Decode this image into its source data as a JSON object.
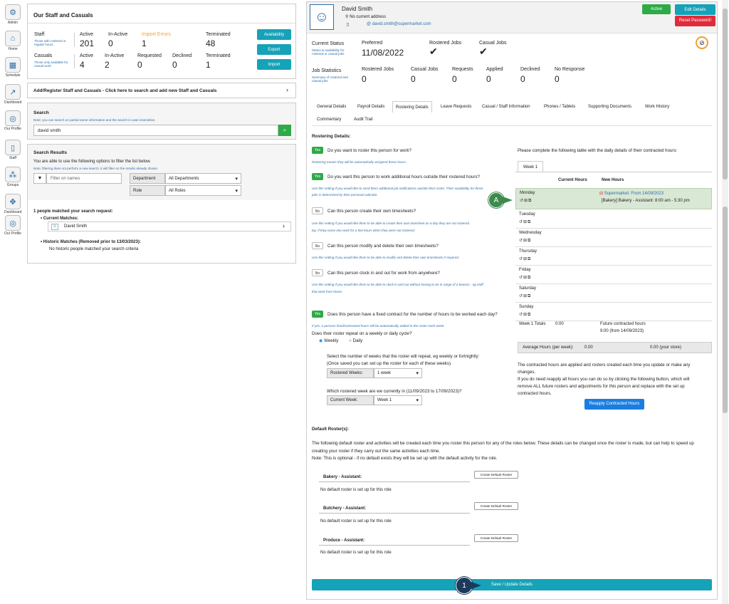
{
  "nav": [
    {
      "label": "Admin",
      "icon": "admin-icon"
    },
    {
      "label": "Home",
      "icon": "home-icon"
    },
    {
      "label": "Schedule",
      "icon": "schedule-icon"
    },
    {
      "label": "Dashboard",
      "icon": "dashboard-icon"
    },
    {
      "label": "Our Profile",
      "icon": "profile-icon"
    },
    {
      "label": "Staff",
      "icon": "staff-icon"
    },
    {
      "label": "Groups",
      "icon": "groups-icon"
    },
    {
      "label": "Dashboard",
      "icon": "dashboard-icon"
    },
    {
      "label": "Our Profile",
      "icon": "profile-icon"
    }
  ],
  "summary": {
    "title": "Our Staff and Casuals",
    "staff_label": "Staff",
    "staff_sub": "Those with rostered or regular hours",
    "casuals_label": "Casuals",
    "casuals_sub": "Those only available for casual work",
    "staff_cols": [
      {
        "h": "Active",
        "v": "201"
      },
      {
        "h": "In-Active",
        "v": "0"
      },
      {
        "h": "Import Errors",
        "v": "1"
      },
      {
        "h": "Terminated",
        "v": "48"
      }
    ],
    "casual_cols": [
      {
        "h": "Active",
        "v": "4"
      },
      {
        "h": "In-Active",
        "v": "2"
      },
      {
        "h": "Requested",
        "v": "0"
      },
      {
        "h": "Declined",
        "v": "0"
      },
      {
        "h": "Terminated",
        "v": "1"
      }
    ],
    "btn_availability": "Availability",
    "btn_export": "Export",
    "btn_import": "Import"
  },
  "add_register": "Add/Register Staff and Casuals - Click here to search and add new Staff and Casuals",
  "search": {
    "title": "Search",
    "note": "Note: you can search on partial name information and the search is case insensitive.",
    "value": "david smith"
  },
  "results": {
    "title": "Search Results",
    "desc": "You are able to use the following options to filter the list below.",
    "note": "Note: filtering does not perform a new search, it will filter on the results already shown.",
    "filter_placeholder": "Filter on names",
    "dept_label": "Department",
    "dept_value": "All Departments",
    "role_label": "Role",
    "role_value": "All Roles",
    "matched": "1 people matched your search request:",
    "current_matches": "Current Matches:",
    "match_name": "David Smith",
    "historic": "Historic Matches (Removed prior to 13/03/2023):",
    "historic_none": "No historic people matched your search criteria"
  },
  "profile": {
    "name": "David Smith",
    "address": "No current address",
    "email": "david.smith@supermarket.com",
    "status_toggle": "Active",
    "edit_btn": "Edit Details",
    "reset_btn": "Reset Password!"
  },
  "status": {
    "label": "Current Status",
    "sub": "Status & availability for rostered or casual jobs",
    "preferred_h": "Preferred",
    "preferred_v": "11/08/2022",
    "rostered_h": "Rostered Jobs",
    "casual_h": "Casual Jobs"
  },
  "jobstats": {
    "label": "Job Statistics",
    "sub": "Summary of rostered and casual jobs",
    "cols": [
      {
        "h": "Rostered Jobs",
        "v": "0"
      },
      {
        "h": "Casual Jobs",
        "v": "0"
      },
      {
        "h": "Requests",
        "v": "0"
      },
      {
        "h": "Applied",
        "v": "0"
      },
      {
        "h": "Declined",
        "v": "0"
      },
      {
        "h": "No Response",
        "v": "0"
      }
    ]
  },
  "tabs": [
    "General Details",
    "Payroll Details",
    "Rostering Details",
    "Leave Requests",
    "Casual / Staff Information",
    "Phones / Tablets",
    "Supporting Documents",
    "Work History"
  ],
  "tabs2": [
    "Commentary",
    "Audit Trail"
  ],
  "rostering": {
    "title": "Rostering Details:",
    "q1": "Do you want to roster this person for work?",
    "h1": "Rostering means they will be automatically assigned these hours.",
    "q2": "Do you want this person to work additional hours outside their rostered hours?",
    "h2a": "Use this setting if you would like to send them additional job notifications outside their roster. Their availability for these",
    "h2b": "jobs is determined by their personal calendar.",
    "q3": "Can this person create their own timesheets?",
    "h3a": "Use this setting if you would like them to be able to create their own timesheet on a day they are not rostered.",
    "h3b": "Eg. If they come into work for a few hours when they were not rostered.",
    "q4": "Can this person modify and delete their own timesheets?",
    "h4": "Use this setting if you would like them to be able to modify and delete their own timesheets if required.",
    "q5": "Can this person clock in and out for work from anywhere?",
    "h5a": "Use this setting if you would like them to be able to clock in and out without having to be in range of a beacon - eg staff",
    "h5b": "that work from home.",
    "q6": "Does this person have a fixed contract for the number of hours to be worked each day?",
    "h6": "If yes, a persons fixed/contracted hours will be automatically added to the roster each week.",
    "repeat_q": "Does their roster repeat on a weekly or daily cycle?",
    "weekly": "Weekly",
    "daily": "Daily",
    "weeks_q1": "Select the number of weeks that the roster will repeat, eg weekly or fortnightly:",
    "weeks_q2": "(Once saved you can set up the roster for each of these weeks)",
    "rostered_weeks_label": "Rostered Weeks:",
    "rostered_weeks_value": "1 week",
    "current_week_q": "Which rostered week are we currently in (11/09/2023 to 17/09/2023)?",
    "current_week_label": "Current Week:",
    "current_week_value": "Week 1",
    "yes": "Yes",
    "no": "No"
  },
  "contract": {
    "intro": "Please complete the following table with the daily details of their contracted hours:",
    "week_tab": "Week 1",
    "col_current": "Current Hours",
    "col_new": "New Hours",
    "days": [
      "Monday",
      "Tuesday",
      "Wednesday",
      "Thursday",
      "Friday",
      "Saturday",
      "Sunday"
    ],
    "monday_new1": "Supermarket: From 14/09/2023",
    "monday_new2": "[Bakery] Bakery - Assistant: 8:00 am - 5:30 pm",
    "totals_label": "Week 1 Totals",
    "totals_current": "0:00",
    "future1": "Future contracted hours",
    "future2": "9:00 (from 14/09/2023)",
    "avg_label": "Average Hours (per week):",
    "avg_value": "0.00",
    "avg_store": "0.00 (your store)",
    "note1": "The contracted hours are applied and rosters created each time you update or make any",
    "note2": "changes.",
    "note3": "If you do need reapply all hours you can do so by clicking the following button, which will",
    "note4": "remove ALL future rosters and adjustments for this person and replace with the set up",
    "note5": "contracted hours.",
    "reapply_btn": "Reapply Contracted Hours"
  },
  "default": {
    "title": "Default Roster(s):",
    "p1": "The following default roster and activities will be created each time you roster this person for any of the roles below. These details can be changed once the roster is made, but can help to speed up",
    "p2": "creating your roster if they carry out the same activities each time.",
    "p3": "Note: This is optional - if no default exists they will be set up with the default activity for the role.",
    "roles": [
      "Bakery - Assistant:",
      "Butchery - Assistant:",
      "Produce - Assistant:"
    ],
    "none": "No default roster is set up for this role",
    "create_btn": "Create Default Roster"
  },
  "save_btn": "Save / Update Details",
  "callouts": {
    "a": "A",
    "one": "1"
  },
  "colors": {
    "teal": "#16a2b8",
    "green": "#2eaa47",
    "red": "#e02b3a",
    "blue": "#1a7de0",
    "callout": "#3d8a4c"
  }
}
